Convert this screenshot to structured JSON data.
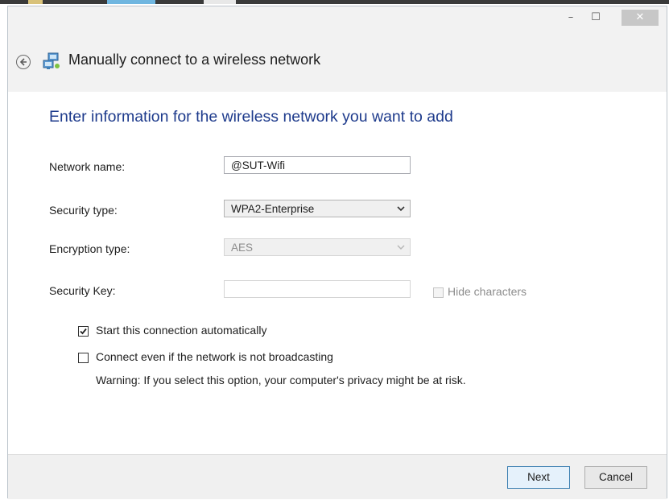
{
  "window": {
    "controls": {
      "minimize": "–",
      "maximize": "☐",
      "close": "✕"
    }
  },
  "nav": {
    "title": "Manually connect to a wireless network"
  },
  "main": {
    "heading": "Enter information for the wireless network you want to add",
    "fields": {
      "network_name": {
        "label": "Network name:",
        "value": "@SUT-Wifi"
      },
      "security_type": {
        "label": "Security type:",
        "value": "WPA2-Enterprise"
      },
      "encryption_type": {
        "label": "Encryption type:",
        "value": "AES"
      },
      "security_key": {
        "label": "Security Key:",
        "value": ""
      }
    },
    "hide_characters": {
      "label": "Hide characters",
      "checked": false
    },
    "start_auto": {
      "label": "Start this connection automatically",
      "checked": true
    },
    "connect_even": {
      "label": "Connect even if the network is not broadcasting",
      "checked": false
    },
    "warning": "Warning: If you select this option, your computer's privacy might be at risk."
  },
  "footer": {
    "next_label": "Next",
    "cancel_label": "Cancel"
  },
  "colors": {
    "heading": "#1e3b8c",
    "titlebar_bg": "#f2f2f2",
    "footer_bg": "#f0f0f0",
    "close_bg": "#c7c7c7"
  }
}
